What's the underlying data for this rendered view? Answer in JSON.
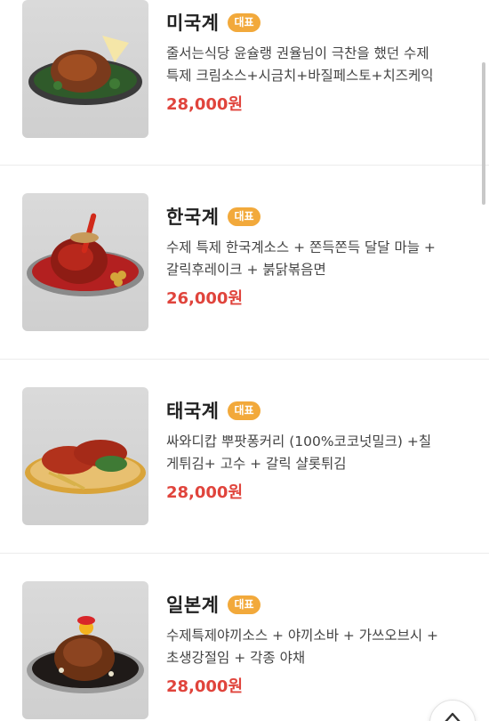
{
  "menu": {
    "items": [
      {
        "name": "미국계",
        "badge": "대표",
        "description": "줄서는식당 윤슐랭 권율님이 극찬을 했던 수제\n특제 크림소스+시금치+바질페스토+치즈케익",
        "price": "28,000원"
      },
      {
        "name": "한국계",
        "badge": "대표",
        "description": "수제 특제 한국계소스 + 쫀득쫀득 달달 마늘 +\n갈릭후레이크 + 붉닭볶음면",
        "price": "26,000원"
      },
      {
        "name": "태국계",
        "badge": "대표",
        "description": "싸와디캅 뿌팟퐁커리 (100%코코넛밀크) +칠\n게튀김+ 고수 + 갈릭 샬롯튀김",
        "price": "28,000원"
      },
      {
        "name": "일본계",
        "badge": "대표",
        "description": "수제특제야끼소스 + 야끼소바 + 가쓰오브시 +\n초생강절임 + 각종 야채",
        "price": "28,000원"
      }
    ]
  },
  "icons": {
    "scroll_top": "arrow-up-icon"
  },
  "colors": {
    "badge": "#f2a93b",
    "price": "#e0443c"
  }
}
